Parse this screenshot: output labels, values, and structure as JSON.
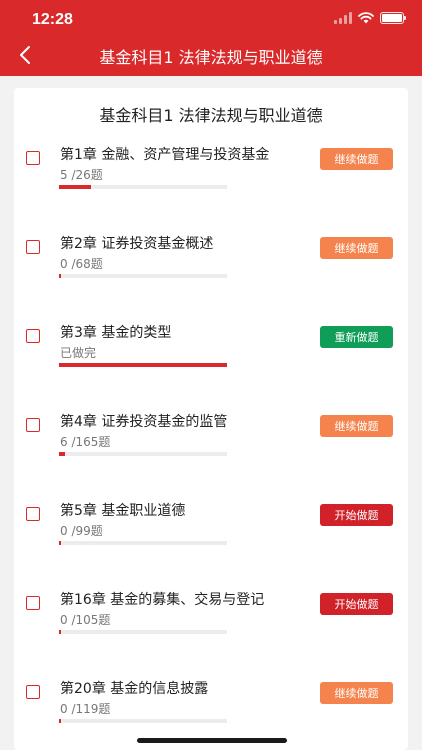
{
  "status_bar": {
    "time": "12:28"
  },
  "header": {
    "title": "基金科目1 法律法规与职业道德"
  },
  "card": {
    "title": "基金科目1 法律法规与职业道德"
  },
  "colors": {
    "brand_red": "#d9292a",
    "continue": "#f5834e",
    "redo": "#0f9d58",
    "start": "#d02228"
  },
  "chapters": [
    {
      "title": "第1章 金融、资产管理与投资基金",
      "progress_text": "5 /26题",
      "progress": 0.192,
      "action": "继续做题",
      "action_type": "continue"
    },
    {
      "title": "第2章 证券投资基金概述",
      "progress_text": "0 /68题",
      "progress": 0.0,
      "action": "继续做题",
      "action_type": "continue"
    },
    {
      "title": "第3章 基金的类型",
      "progress_text": "已做完",
      "progress": 1.0,
      "action": "重新做题",
      "action_type": "redo"
    },
    {
      "title": "第4章 证券投资基金的监管",
      "progress_text": "6 /165题",
      "progress": 0.036,
      "action": "继续做题",
      "action_type": "continue"
    },
    {
      "title": "第5章 基金职业道德",
      "progress_text": "0 /99题",
      "progress": 0.0,
      "action": "开始做题",
      "action_type": "start"
    },
    {
      "title": "第16章 基金的募集、交易与登记",
      "progress_text": "0 /105题",
      "progress": 0.0,
      "action": "开始做题",
      "action_type": "start"
    },
    {
      "title": "第20章 基金的信息披露",
      "progress_text": "0 /119题",
      "progress": 0.0,
      "action": "继续做题",
      "action_type": "continue"
    }
  ]
}
